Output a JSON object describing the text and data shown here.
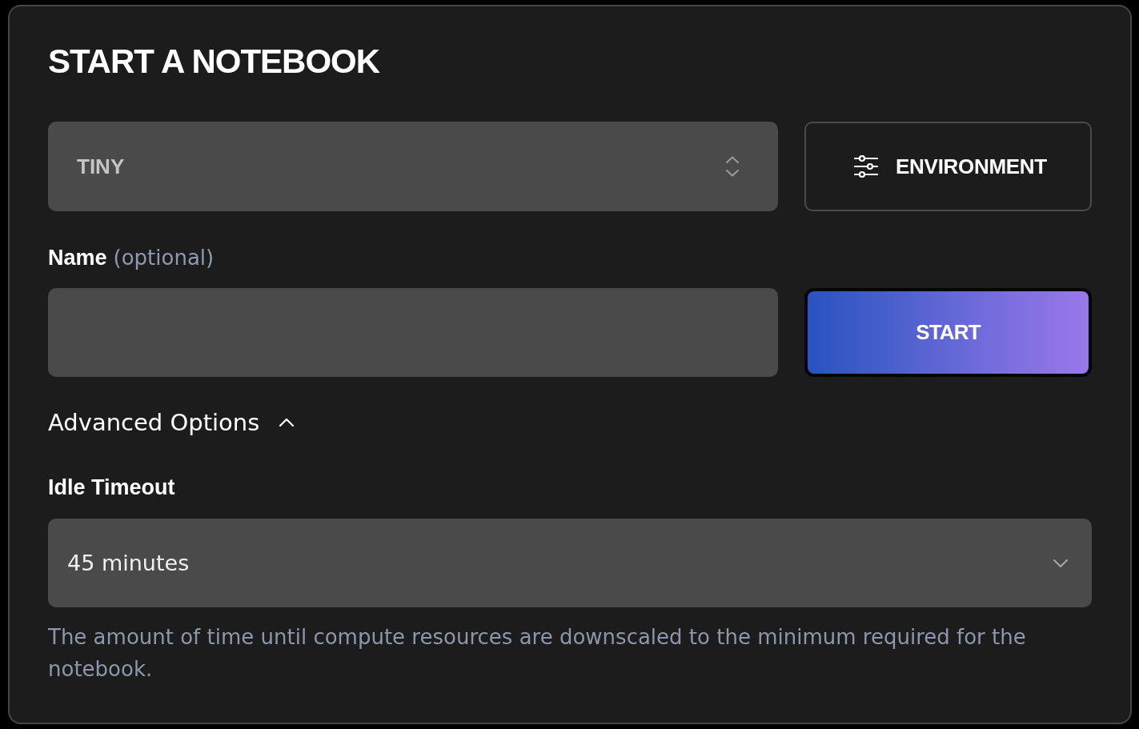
{
  "title": "START A NOTEBOOK",
  "size_select": {
    "value": "TINY"
  },
  "environment_button": {
    "label": "ENVIRONMENT"
  },
  "name_field": {
    "label": "Name",
    "hint": "(optional)"
  },
  "start_button": {
    "label": "START"
  },
  "advanced_options": {
    "label": "Advanced Options",
    "expanded": true
  },
  "idle_timeout": {
    "label": "Idle Timeout",
    "value": "45 minutes",
    "help": "The amount of time until compute resources are downscaled to the minimum required for the notebook."
  }
}
